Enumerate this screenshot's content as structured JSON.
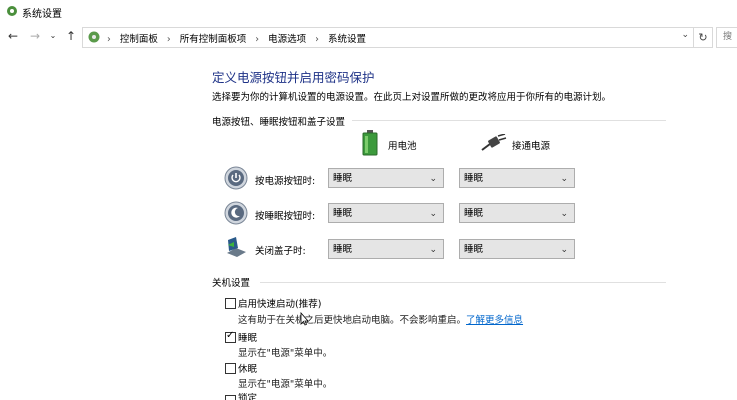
{
  "window": {
    "title": "系统设置"
  },
  "address": {
    "crumbs": [
      "控制面板",
      "所有控制面板项",
      "电源选项",
      "系统设置"
    ],
    "search_placeholder": "搜"
  },
  "main": {
    "heading": "定义电源按钮并启用密码保护",
    "description": "选择要为你的计算机设置的电源设置。在此页上对设置所做的更改将应用于你所有的电源计划。",
    "section1_title": "电源按钮、睡眠按钮和盖子设置",
    "col_battery": "用电池",
    "col_plugged": "接通电源",
    "rows": [
      {
        "label": "按电源按钮时:",
        "battery": "睡眠",
        "plugged": "睡眠"
      },
      {
        "label": "按睡眠按钮时:",
        "battery": "睡眠",
        "plugged": "睡眠"
      },
      {
        "label": "关闭盖子时:",
        "battery": "睡眠",
        "plugged": "睡眠"
      }
    ],
    "section2_title": "关机设置",
    "shutdown": {
      "fast_startup_label": "启用快速启动(推荐)",
      "fast_startup_desc": "这有助于在关机之后更快地启动电脑。不会影响重启。",
      "fast_startup_link": "了解更多信息",
      "sleep_label": "睡眠",
      "sleep_desc": "显示在\"电源\"菜单中。",
      "hibernate_label": "休眠",
      "hibernate_desc": "显示在\"电源\"菜单中。",
      "lock_label": "锁定"
    }
  },
  "colors": {
    "heading": "#1e3287",
    "link": "#0066cc",
    "select_bg": "#e5e5e5"
  }
}
